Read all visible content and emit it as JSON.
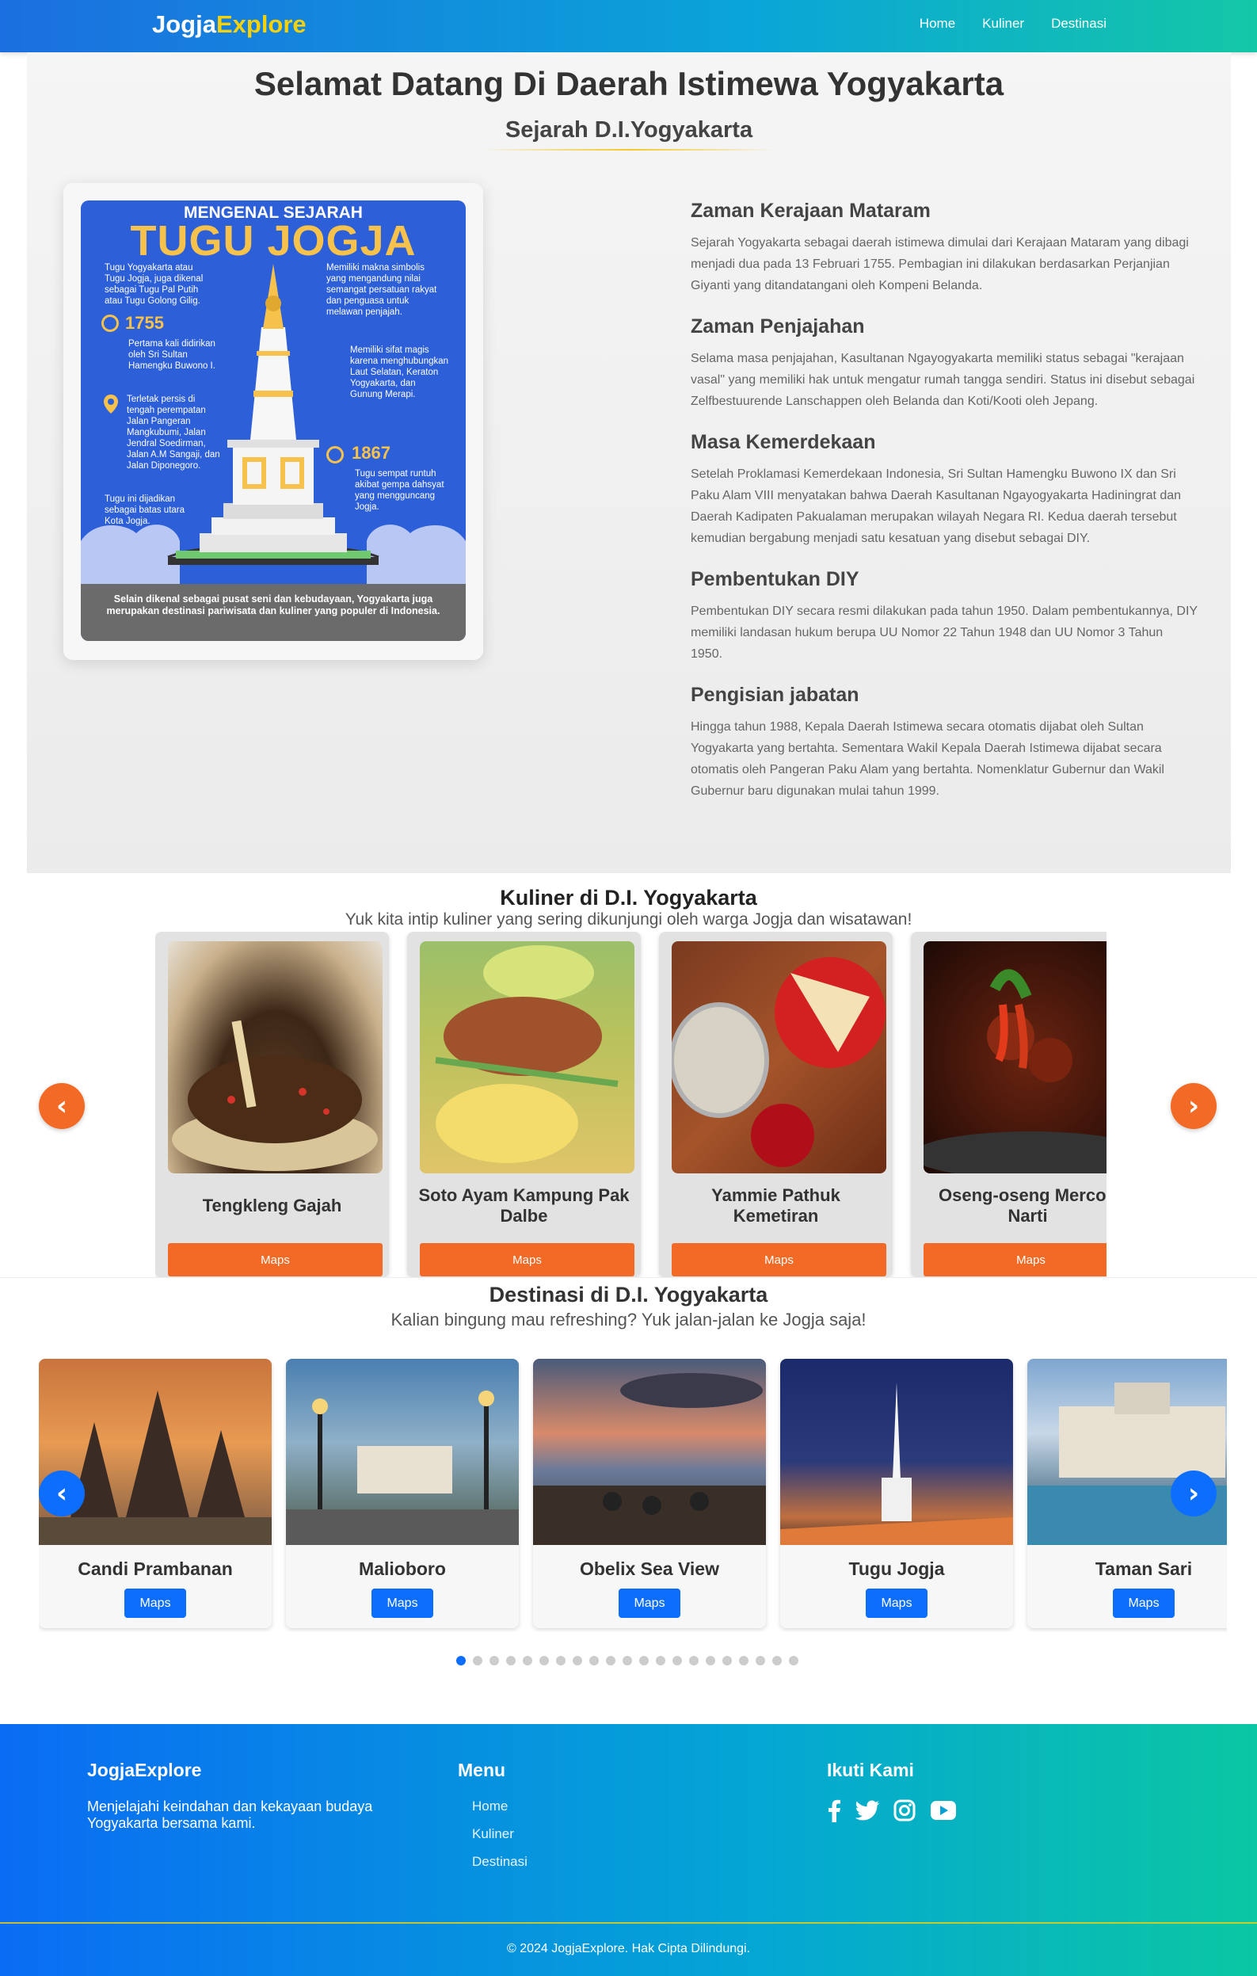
{
  "nav": {
    "brand_part1": "Jogja",
    "brand_part2": "Explore",
    "links": [
      "Home",
      "Kuliner",
      "Destinasi"
    ]
  },
  "history": {
    "title": "Selamat Datang Di Daerah Istimewa Yogyakarta",
    "subtitle": "Sejarah D.I.Yogyakarta",
    "poster": {
      "heading_small": "MENGENAL SEJARAH",
      "heading_big": "TUGU JOGJA",
      "note1": "Tugu Yogyakarta atau Tugu Jogja, juga dikenal sebagai Tugu Pal Putih atau Tugu Golong Gilig.",
      "note2": "Memiliki makna simbolis yang mengandung nilai semangat persatuan rakyat dan penguasa untuk melawan penjajah.",
      "year1": "1755",
      "note3": "Pertama kali didirikan oleh Sri Sultan Hamengku Buwono I.",
      "note4": "Memiliki sifat magis karena menghubungkan Laut Selatan, Keraton Yogyakarta, dan Gunung Merapi.",
      "note5": "Terletak persis di tengah perempatan Jalan Pangeran Mangkubumi, Jalan Jendral Soedirman, Jalan A.M Sangaji, dan Jalan Diponegoro.",
      "year2": "1867",
      "note6": "Tugu sempat runtuh akibat gempa dahsyat yang mengguncang Jogja.",
      "note7": "Tugu ini dijadikan sebagai batas utara Kota Jogja.",
      "footer": "Selain dikenal sebagai pusat seni dan kebudayaan, Yogyakarta juga merupakan destinasi pariwisata dan kuliner yang populer di Indonesia."
    },
    "topics": [
      {
        "title": "Zaman Kerajaan Mataram",
        "text": "Sejarah Yogyakarta sebagai daerah istimewa dimulai dari Kerajaan Mataram yang dibagi menjadi dua pada 13 Februari 1755. Pembagian ini dilakukan berdasarkan Perjanjian Giyanti yang ditandatangani oleh Kompeni Belanda."
      },
      {
        "title": "Zaman Penjajahan",
        "text": "Selama masa penjajahan, Kasultanan Ngayogyakarta memiliki status sebagai \"kerajaan vasal\" yang memiliki hak untuk mengatur rumah tangga sendiri. Status ini disebut sebagai Zelfbestuurende Lanschappen oleh Belanda dan Koti/Kooti oleh Jepang."
      },
      {
        "title": "Masa Kemerdekaan",
        "text": "Setelah Proklamasi Kemerdekaan Indonesia, Sri Sultan Hamengku Buwono IX dan Sri Paku Alam VIII menyatakan bahwa Daerah Kasultanan Ngayogyakarta Hadiningrat dan Daerah Kadipaten Pakualaman merupakan wilayah Negara RI. Kedua daerah tersebut kemudian bergabung menjadi satu kesatuan yang disebut sebagai DIY."
      },
      {
        "title": "Pembentukan DIY",
        "text": "Pembentukan DIY secara resmi dilakukan pada tahun 1950. Dalam pembentukannya, DIY memiliki landasan hukum berupa UU Nomor 22 Tahun 1948 dan UU Nomor 3 Tahun 1950."
      },
      {
        "title": "Pengisian jabatan",
        "text": "Hingga tahun 1988, Kepala Daerah Istimewa secara otomatis dijabat oleh Sultan Yogyakarta yang bertahta. Sementara Wakil Kepala Daerah Istimewa dijabat secara otomatis oleh Pangeran Paku Alam yang bertahta. Nomenklatur Gubernur dan Wakil Gubernur baru digunakan mulai tahun 1999."
      }
    ]
  },
  "kuliner": {
    "title": "Kuliner di D.I. Yogyakarta",
    "subtitle": "Yuk kita intip kuliner yang sering dikunjungi oleh warga Jogja dan wisatawan!",
    "prev_label": "‹",
    "next_label": "›",
    "items": [
      {
        "name": "Tengkleng Gajah",
        "button": "Maps"
      },
      {
        "name": "Soto Ayam Kampung Pak Dalbe",
        "button": "Maps"
      },
      {
        "name": "Yammie Pathuk Kemetiran",
        "button": "Maps"
      },
      {
        "name": "Oseng-oseng Mercon Narti",
        "button": "Maps"
      }
    ]
  },
  "destinasi": {
    "title": "Destinasi di D.I. Yogyakarta",
    "subtitle": "Kalian bingung mau refreshing? Yuk jalan-jalan ke Jogja saja!",
    "prev_label": "‹",
    "next_label": "›",
    "items": [
      {
        "name": "Candi Prambanan",
        "button": "Maps"
      },
      {
        "name": "Malioboro",
        "button": "Maps"
      },
      {
        "name": "Obelix Sea View",
        "button": "Maps"
      },
      {
        "name": "Tugu Jogja",
        "button": "Maps"
      },
      {
        "name": "Taman Sari",
        "button": "Maps"
      }
    ],
    "dots_total": 21,
    "dots_active_index": 0
  },
  "footer": {
    "brand": "JogjaExplore",
    "description": "Menjelajahi keindahan dan kekayaan budaya Yogyakarta bersama kami.",
    "menu_title": "Menu",
    "menu": [
      "Home",
      "Kuliner",
      "Destinasi"
    ],
    "follow_title": "Ikuti Kami",
    "social_icons": [
      "facebook-icon",
      "twitter-icon",
      "instagram-icon",
      "youtube-icon"
    ],
    "copyright": "© 2024 JogjaExplore. Hak Cipta Dilindungi."
  },
  "colors": {
    "accent_orange": "#f26a25",
    "accent_blue": "#0d6efd",
    "brand_yellow": "#f5d10a"
  }
}
